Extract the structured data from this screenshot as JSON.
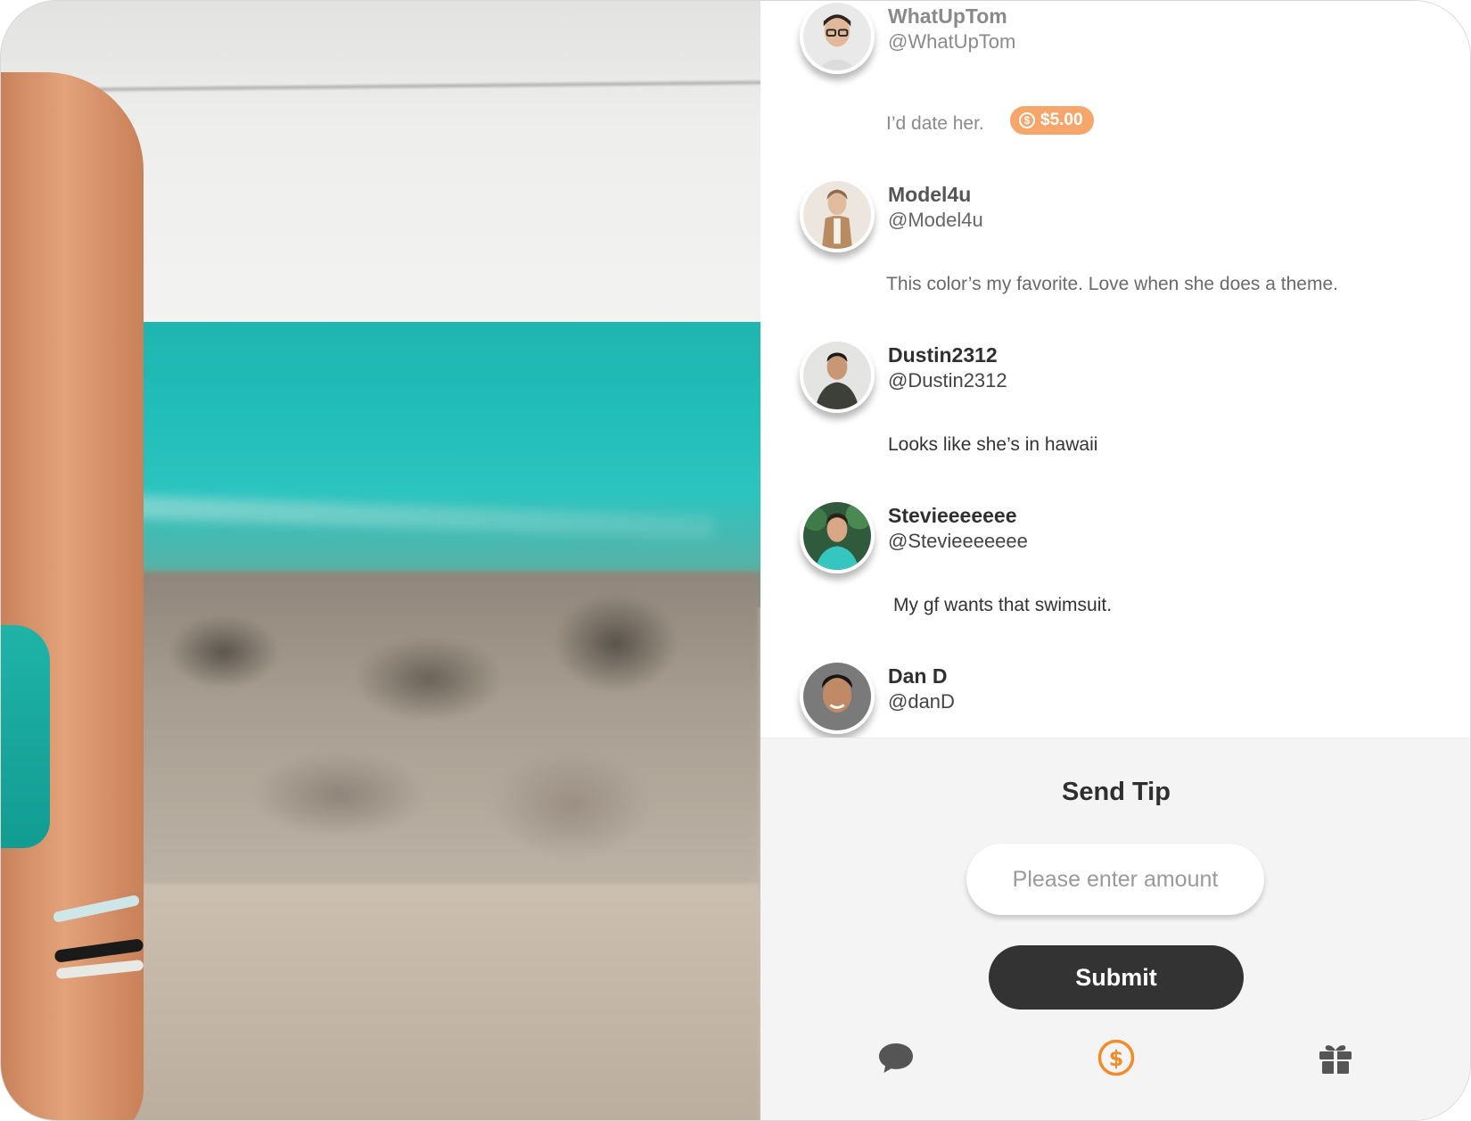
{
  "comments": [
    {
      "username": "WhatUpTom",
      "handle": "@WhatUpTom",
      "message": "I’d date her.",
      "tip": "$5.00",
      "avatar": "avatar-whatuptom"
    },
    {
      "username": "Model4u",
      "handle": "@Model4u",
      "message": "This color’s my favorite. Love when she does a theme.",
      "avatar": "avatar-model4u"
    },
    {
      "username": "Dustin2312",
      "handle": "@Dustin2312",
      "message": "Looks like she’s in hawaii",
      "avatar": "avatar-dustin2312"
    },
    {
      "username": "Stevieeeeeee",
      "handle": "@Stevieeeeeee",
      "message": "My gf wants that swimsuit.",
      "avatar": "avatar-stevie"
    },
    {
      "username": "Dan D",
      "handle": "@danD",
      "avatar": "avatar-dan-d"
    }
  ],
  "tip_panel": {
    "title": "Send Tip",
    "amount_placeholder": "Please enter amount",
    "amount_value": "",
    "submit_label": "Submit"
  },
  "bottom_nav": [
    {
      "icon": "chat-bubble-icon",
      "active": false
    },
    {
      "icon": "dollar-coin-icon",
      "active": true
    },
    {
      "icon": "gift-icon",
      "active": false
    }
  ],
  "colors": {
    "accent": "#f28c28",
    "tip_badge": "#f7a66b",
    "button": "#333333",
    "panel": "#f4f4f4",
    "icon_inactive": "#555555"
  }
}
